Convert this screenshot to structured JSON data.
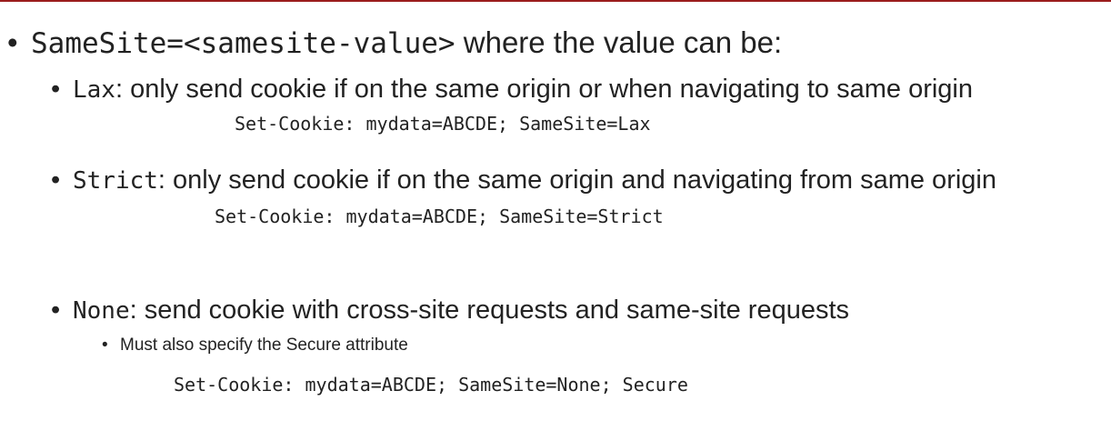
{
  "colors": {
    "rule": "#9b1c1c",
    "text": "#222222"
  },
  "heading": {
    "bullet": "•",
    "attribute": "SameSite=<samesite-value>",
    "text": " where the value can be:"
  },
  "items": [
    {
      "bullet": "•",
      "value": "Lax",
      "description": ": only send cookie if on the same origin or when navigating to same origin",
      "code": "Set-Cookie: mydata=ABCDE; SameSite=Lax"
    },
    {
      "bullet": "•",
      "value": "Strict",
      "description": ": only send cookie if on the same origin and navigating from same origin",
      "code": "Set-Cookie: mydata=ABCDE; SameSite=Strict"
    },
    {
      "bullet": "•",
      "value": "None",
      "description": ": send cookie with cross-site requests and same-site requests",
      "sub_bullet": "•",
      "note": "Must also specify the Secure attribute",
      "code": "Set-Cookie: mydata=ABCDE; SameSite=None; Secure"
    }
  ]
}
